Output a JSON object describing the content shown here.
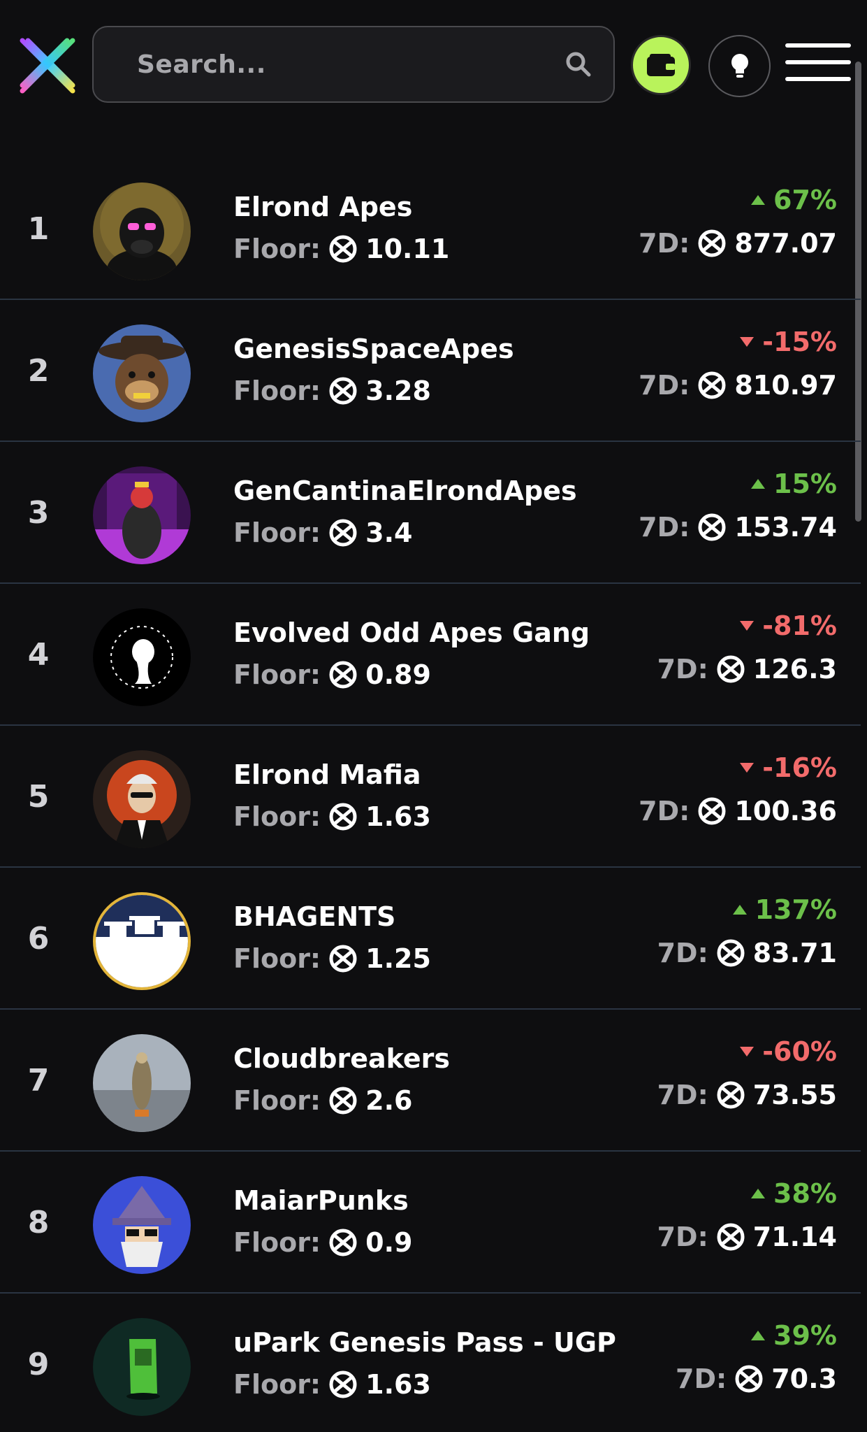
{
  "header": {
    "search": {
      "placeholder": "Search..."
    },
    "wallet_icon": "wallet-icon",
    "theme_icon": "lightbulb-icon",
    "menu_icon": "hamburger-menu-icon",
    "accent_color": "#b9f35b"
  },
  "labels": {
    "floor": "Floor:",
    "seven_day": "7D:"
  },
  "colors": {
    "up": "#6cc04a",
    "down": "#f26b6b",
    "background": "#0e0e10"
  },
  "collections": [
    {
      "rank": "1",
      "name": "Elrond Apes",
      "floor": "10.11",
      "change": "67%",
      "direction": "up",
      "volume_7d": "877.07"
    },
    {
      "rank": "2",
      "name": "GenesisSpaceApes",
      "floor": "3.28",
      "change": "-15%",
      "direction": "down",
      "volume_7d": "810.97"
    },
    {
      "rank": "3",
      "name": "GenCantinaElrondApes",
      "floor": "3.4",
      "change": "15%",
      "direction": "up",
      "volume_7d": "153.74"
    },
    {
      "rank": "4",
      "name": "Evolved Odd Apes Gang",
      "floor": "0.89",
      "change": "-81%",
      "direction": "down",
      "volume_7d": "126.3"
    },
    {
      "rank": "5",
      "name": "Elrond Mafia",
      "floor": "1.63",
      "change": "-16%",
      "direction": "down",
      "volume_7d": "100.36"
    },
    {
      "rank": "6",
      "name": "BHAGENTS",
      "floor": "1.25",
      "change": "137%",
      "direction": "up",
      "volume_7d": "83.71"
    },
    {
      "rank": "7",
      "name": "Cloudbreakers",
      "floor": "2.6",
      "change": "-60%",
      "direction": "down",
      "volume_7d": "73.55"
    },
    {
      "rank": "8",
      "name": "MaiarPunks",
      "floor": "0.9",
      "change": "38%",
      "direction": "up",
      "volume_7d": "71.14"
    },
    {
      "rank": "9",
      "name": "uPark Genesis Pass - UGP",
      "floor": "1.63",
      "change": "39%",
      "direction": "up",
      "volume_7d": "70.3"
    }
  ]
}
